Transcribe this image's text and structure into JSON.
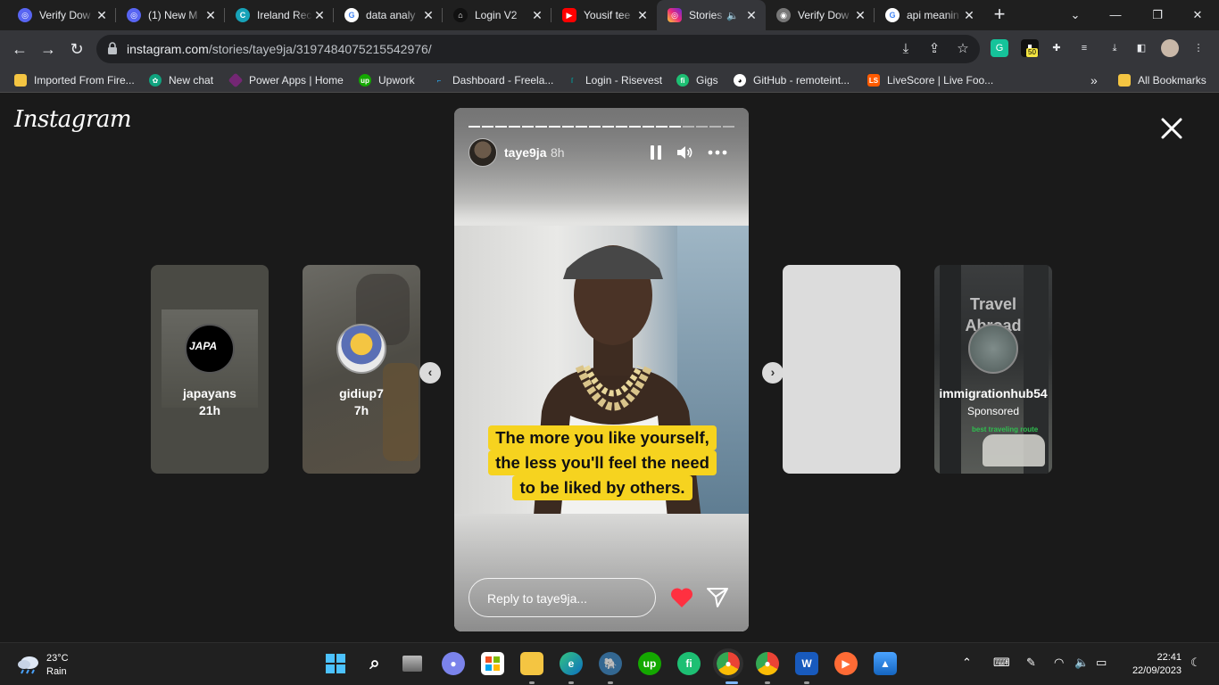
{
  "browser": {
    "tabs": [
      {
        "title": "Verify Dow",
        "icon": "verify-icon",
        "color": "#5865f2"
      },
      {
        "title": "(1) New M",
        "icon": "verify-icon",
        "color": "#5865f2"
      },
      {
        "title": "Ireland Rec",
        "icon": "ireland-icon",
        "color": "#17a2b8"
      },
      {
        "title": "data analy",
        "icon": "google-icon",
        "color": "#4285f4"
      },
      {
        "title": "Login V2",
        "icon": "login-icon",
        "color": "#222222"
      },
      {
        "title": "Yousif tee",
        "icon": "youtube-icon",
        "color": "#ff0000"
      },
      {
        "title": "Stories",
        "icon": "instagram-icon",
        "color": "#e1306c"
      },
      {
        "title": "Verify Dow",
        "icon": "globe-icon",
        "color": "#888888"
      },
      {
        "title": "api meanin",
        "icon": "google-icon",
        "color": "#4285f4"
      }
    ],
    "new_tab": "+",
    "address": {
      "domain": "instagram.com",
      "path": "/stories/taye9ja/3197484075215542976/"
    },
    "extension_badge": "50",
    "bookmarks": [
      "Imported From Fire...",
      "New chat",
      "Power Apps | Home",
      "Upwork",
      "Dashboard - Freela...",
      "Login - Risevest",
      "Gigs",
      "GitHub - remoteint...",
      "LiveScore | Live Foo..."
    ],
    "bookmarks_overflow": "»",
    "all_bookmarks": "All Bookmarks"
  },
  "instagram": {
    "logo": "Instagram",
    "previews_left": [
      {
        "username": "japayans",
        "time": "21h",
        "avatar_text": "JAPA"
      },
      {
        "username": "gidiup7",
        "time": "7h"
      }
    ],
    "previews_right": [
      {
        "username": "",
        "time": ""
      },
      {
        "username": "immigrationhub54",
        "time": "Sponsored",
        "overlay_title": "Travel Abroad",
        "overlay_sub": "best traveling route"
      }
    ],
    "story": {
      "username": "taye9ja",
      "time": "8h",
      "progress_total": 20,
      "progress_done": 16,
      "caption_lines": [
        "The more you like yourself,",
        "the less you'll feel the need",
        "to be liked by others."
      ],
      "reply_placeholder": "Reply to taye9ja..."
    }
  },
  "taskbar": {
    "weather_temp": "23°C",
    "weather_desc": "Rain",
    "time": "22:41",
    "date": "22/09/2023"
  }
}
